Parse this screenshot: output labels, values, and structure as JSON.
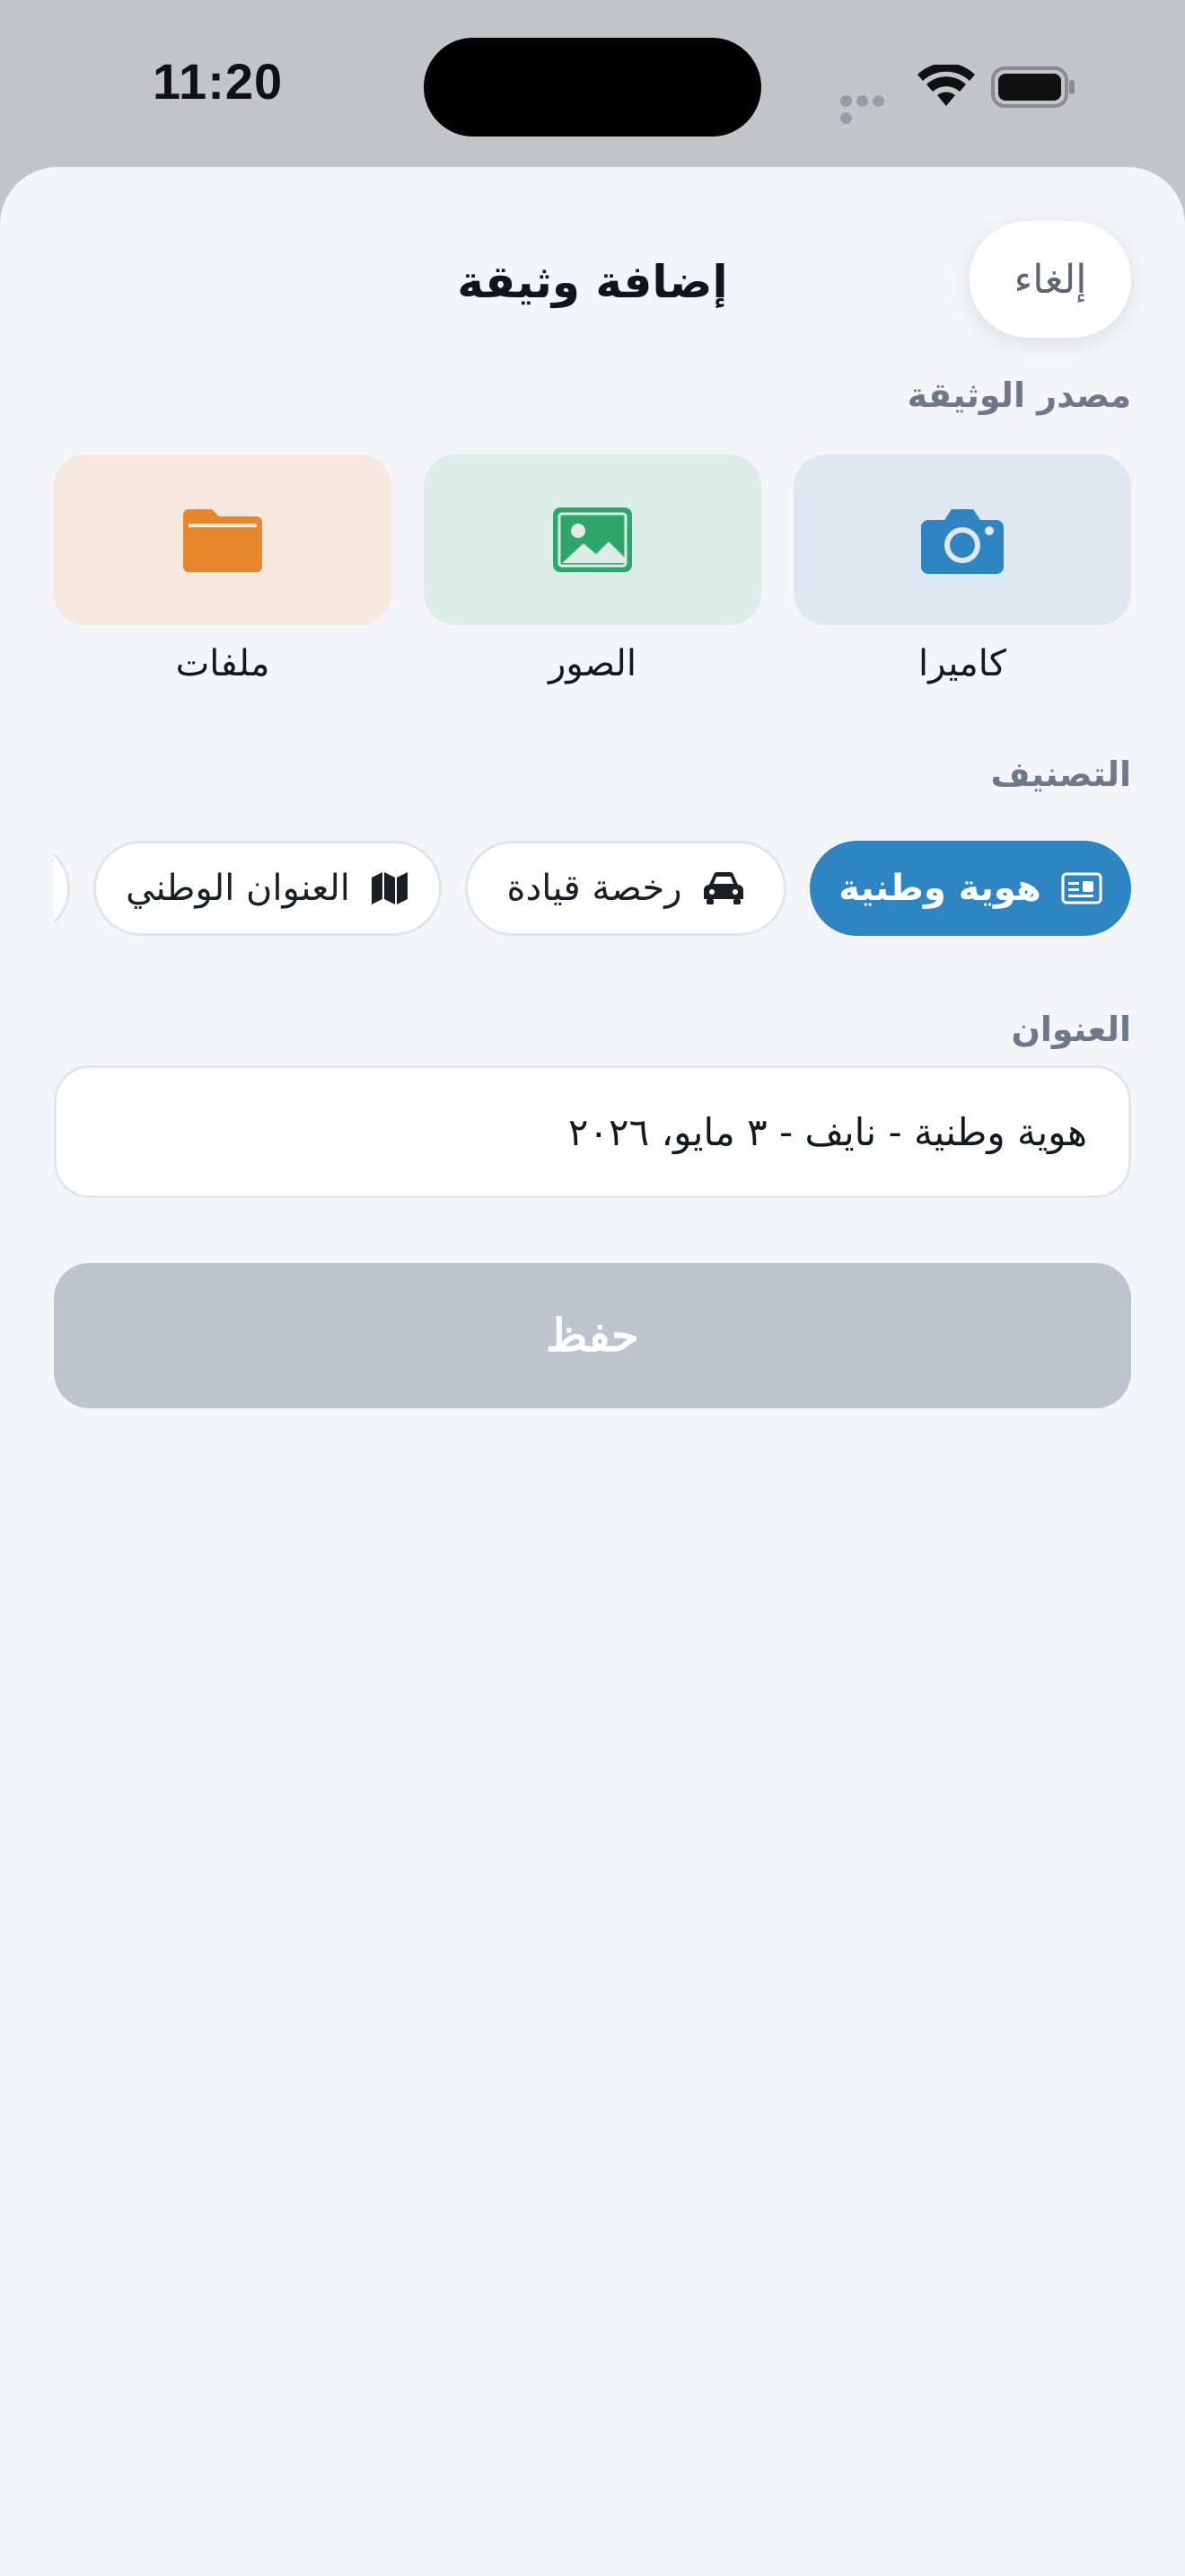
{
  "status_bar": {
    "time": "11:20"
  },
  "header": {
    "title": "إضافة وثيقة",
    "cancel_label": "إلغاء"
  },
  "source_section": {
    "label": "مصدر الوثيقة",
    "options": [
      {
        "label": "كاميرا",
        "icon": "camera-icon",
        "color": "#2f84c2",
        "bg": "#dde8f1"
      },
      {
        "label": "الصور",
        "icon": "photo-icon",
        "color": "#2ea66b",
        "bg": "#dbede6"
      },
      {
        "label": "ملفات",
        "icon": "folder-icon",
        "color": "#e8862e",
        "bg": "#f4e8df"
      }
    ]
  },
  "category_section": {
    "label": "التصنيف",
    "chips": [
      {
        "label": "هوية وطنية",
        "icon": "id-card-icon",
        "selected": true
      },
      {
        "label": "رخصة قيادة",
        "icon": "car-icon",
        "selected": false
      },
      {
        "label": "العنوان الوطني",
        "icon": "map-icon",
        "selected": false
      }
    ]
  },
  "title_section": {
    "label": "العنوان",
    "value": "هوية وطنية - نايف - ٣ مايو، ٢٠٢٦"
  },
  "actions": {
    "save_label": "حفظ"
  },
  "colors": {
    "accent": "#2f84c2",
    "save_disabled": "#bec4cd"
  }
}
